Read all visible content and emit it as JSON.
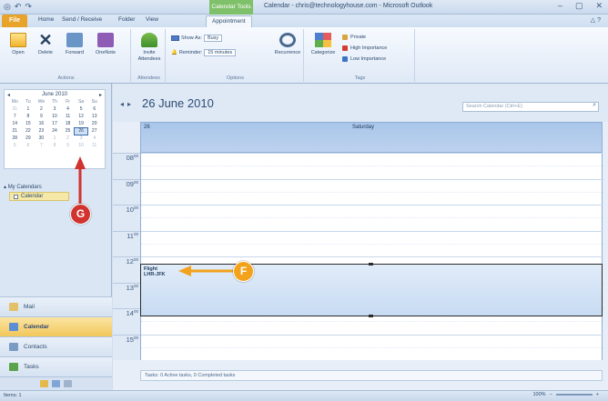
{
  "window": {
    "qat_icons": [
      "outlook-logo-icon",
      "undo-icon",
      "redo-icon"
    ],
    "qat_glyphs": [
      "◎",
      "↶",
      "↷"
    ],
    "context_tab_title": "Calendar Tools",
    "title": "Calendar - chris@technologyhouse.com - Microsoft Outlook",
    "controls": [
      "–",
      "▢",
      "✕"
    ]
  },
  "ribbon_tabs": {
    "file": "File",
    "items": [
      "Home",
      "Send / Receive",
      "Folder",
      "View",
      "Appointment"
    ],
    "active_index": 4,
    "right_controls": "△ ?"
  },
  "ribbon": {
    "actions": {
      "label": "Actions",
      "buttons": [
        "Open",
        "Delete",
        "Forward",
        "OneNote"
      ]
    },
    "attendees": {
      "label": "Attendees",
      "button": "Invite Attendees"
    },
    "options": {
      "label": "Options",
      "show_as_label": "Show As:",
      "show_as_value": "Busy",
      "reminder_label": "Reminder:",
      "reminder_value": "15 minutes",
      "recurrence": "Recurrence"
    },
    "tags": {
      "label": "Tags",
      "categorize": "Categorize",
      "private": "Private",
      "high": "High Importance",
      "low": "Low Importance"
    }
  },
  "mini_calendar": {
    "title": "June 2010",
    "weekdays": [
      "Mo",
      "Tu",
      "We",
      "Th",
      "Fr",
      "Sa",
      "Su"
    ],
    "days": [
      "31",
      "1",
      "2",
      "3",
      "4",
      "5",
      "6",
      "7",
      "8",
      "9",
      "10",
      "11",
      "12",
      "13",
      "14",
      "15",
      "16",
      "17",
      "18",
      "19",
      "20",
      "21",
      "22",
      "23",
      "24",
      "25",
      "26",
      "27",
      "28",
      "29",
      "30",
      "1",
      "2",
      "3",
      "4",
      "5",
      "6",
      "7",
      "8",
      "9",
      "10",
      "11"
    ],
    "selected_day": "26"
  },
  "nav": {
    "group_title": "My Calendars",
    "calendar_item": "Calendar",
    "buttons": [
      "Mail",
      "Calendar",
      "Contacts",
      "Tasks"
    ],
    "active_button": "Calendar"
  },
  "calendar": {
    "date_title": "26 June 2010",
    "search_placeholder": "Search Calendar (Ctrl+E)",
    "day_number": "26",
    "day_name": "Saturday",
    "hours": [
      "08",
      "09",
      "10",
      "11",
      "12",
      "13",
      "14",
      "15"
    ],
    "appointment": {
      "subject": "Flight",
      "location": "LHR-JFK"
    },
    "tasks_bar": "Tasks: 0 Active tasks, 0 Completed tasks"
  },
  "status": {
    "left": "Items: 1",
    "zoom": "100%"
  },
  "annotations": {
    "g": "G",
    "f": "F"
  },
  "colors": {
    "accent_blue": "#a9c6e9",
    "appointment": "#c7dbf3",
    "callout_g": "#d1332f",
    "callout_f": "#f2a21b",
    "file_tab": "#e8a32a",
    "context_tab": "#7fc06a"
  }
}
